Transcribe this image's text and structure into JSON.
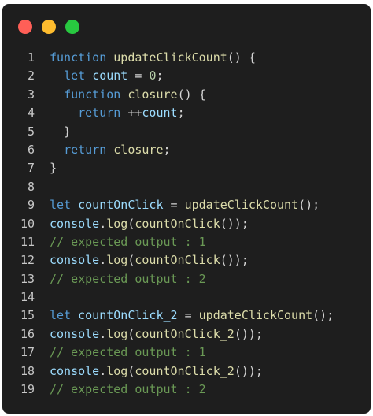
{
  "window": {
    "controls": {
      "close_color": "#ff5f57",
      "minimize_color": "#febc2e",
      "maximize_color": "#28c840"
    }
  },
  "code": {
    "lines": [
      {
        "number": "1",
        "tokens": [
          {
            "text": "function",
            "type": "kw"
          },
          {
            "text": " ",
            "type": "pl"
          },
          {
            "text": "updateClickCount",
            "type": "fn"
          },
          {
            "text": "() {",
            "type": "pl"
          }
        ]
      },
      {
        "number": "2",
        "tokens": [
          {
            "text": "  ",
            "type": "pl"
          },
          {
            "text": "let",
            "type": "kw"
          },
          {
            "text": " ",
            "type": "pl"
          },
          {
            "text": "count",
            "type": "var"
          },
          {
            "text": " = ",
            "type": "pl"
          },
          {
            "text": "0",
            "type": "num"
          },
          {
            "text": ";",
            "type": "pl"
          }
        ]
      },
      {
        "number": "3",
        "tokens": [
          {
            "text": "  ",
            "type": "pl"
          },
          {
            "text": "function",
            "type": "kw"
          },
          {
            "text": " ",
            "type": "pl"
          },
          {
            "text": "closure",
            "type": "fn"
          },
          {
            "text": "() {",
            "type": "pl"
          }
        ]
      },
      {
        "number": "4",
        "tokens": [
          {
            "text": "    ",
            "type": "pl"
          },
          {
            "text": "return",
            "type": "kw"
          },
          {
            "text": " ++",
            "type": "pl"
          },
          {
            "text": "count",
            "type": "var"
          },
          {
            "text": ";",
            "type": "pl"
          }
        ]
      },
      {
        "number": "5",
        "tokens": [
          {
            "text": "  }",
            "type": "pl"
          }
        ]
      },
      {
        "number": "6",
        "tokens": [
          {
            "text": "  ",
            "type": "pl"
          },
          {
            "text": "return",
            "type": "kw"
          },
          {
            "text": " ",
            "type": "pl"
          },
          {
            "text": "closure",
            "type": "fn"
          },
          {
            "text": ";",
            "type": "pl"
          }
        ]
      },
      {
        "number": "7",
        "tokens": [
          {
            "text": "}",
            "type": "pl"
          }
        ]
      },
      {
        "number": "8",
        "tokens": []
      },
      {
        "number": "9",
        "tokens": [
          {
            "text": "let",
            "type": "kw"
          },
          {
            "text": " ",
            "type": "pl"
          },
          {
            "text": "countOnClick",
            "type": "var"
          },
          {
            "text": " = ",
            "type": "pl"
          },
          {
            "text": "updateClickCount",
            "type": "fn"
          },
          {
            "text": "();",
            "type": "pl"
          }
        ]
      },
      {
        "number": "10",
        "tokens": [
          {
            "text": "console",
            "type": "var"
          },
          {
            "text": ".",
            "type": "pl"
          },
          {
            "text": "log",
            "type": "fn"
          },
          {
            "text": "(",
            "type": "pl"
          },
          {
            "text": "countOnClick",
            "type": "fn"
          },
          {
            "text": "());",
            "type": "pl"
          }
        ]
      },
      {
        "number": "11",
        "tokens": [
          {
            "text": "// expected output : 1",
            "type": "cmt"
          }
        ]
      },
      {
        "number": "12",
        "tokens": [
          {
            "text": "console",
            "type": "var"
          },
          {
            "text": ".",
            "type": "pl"
          },
          {
            "text": "log",
            "type": "fn"
          },
          {
            "text": "(",
            "type": "pl"
          },
          {
            "text": "countOnClick",
            "type": "fn"
          },
          {
            "text": "());",
            "type": "pl"
          }
        ]
      },
      {
        "number": "13",
        "tokens": [
          {
            "text": "// expected output : 2",
            "type": "cmt"
          }
        ]
      },
      {
        "number": "14",
        "tokens": []
      },
      {
        "number": "15",
        "tokens": [
          {
            "text": "let",
            "type": "kw"
          },
          {
            "text": " ",
            "type": "pl"
          },
          {
            "text": "countOnClick_2",
            "type": "var"
          },
          {
            "text": " = ",
            "type": "pl"
          },
          {
            "text": "updateClickCount",
            "type": "fn"
          },
          {
            "text": "();",
            "type": "pl"
          }
        ]
      },
      {
        "number": "16",
        "tokens": [
          {
            "text": "console",
            "type": "var"
          },
          {
            "text": ".",
            "type": "pl"
          },
          {
            "text": "log",
            "type": "fn"
          },
          {
            "text": "(",
            "type": "pl"
          },
          {
            "text": "countOnClick_2",
            "type": "fn"
          },
          {
            "text": "());",
            "type": "pl"
          }
        ]
      },
      {
        "number": "17",
        "tokens": [
          {
            "text": "// expected output : 1",
            "type": "cmt"
          }
        ]
      },
      {
        "number": "18",
        "tokens": [
          {
            "text": "console",
            "type": "var"
          },
          {
            "text": ".",
            "type": "pl"
          },
          {
            "text": "log",
            "type": "fn"
          },
          {
            "text": "(",
            "type": "pl"
          },
          {
            "text": "countOnClick_2",
            "type": "fn"
          },
          {
            "text": "());",
            "type": "pl"
          }
        ]
      },
      {
        "number": "19",
        "tokens": [
          {
            "text": "// expected output : 2",
            "type": "cmt"
          }
        ]
      }
    ]
  }
}
